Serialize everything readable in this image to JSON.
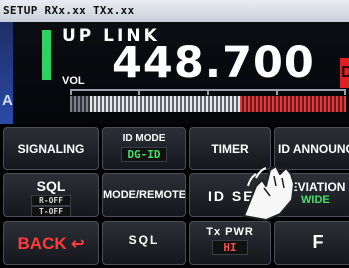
{
  "status_bar": {
    "text": "SETUP RXx.xx TXx.xx"
  },
  "display": {
    "band_label": "UP LINK",
    "frequency": "448.700",
    "volume_label": "VOL",
    "vfo_letter": "A",
    "mode_badge": "DN"
  },
  "buttons": {
    "signaling": "SIGNALING",
    "id_mode_label": "ID MODE",
    "id_mode_value": "DG-ID",
    "timer": "TIMER",
    "id_announce": "ID ANNOUNCE",
    "sql_label": "SQL",
    "sql_r": "R-OFF",
    "sql_t": "T-OFF",
    "mode_remote": "MODE/REMOTE",
    "id_select": "ID SEL",
    "deviation_label": "DEVIATION",
    "deviation_value": "WIDE",
    "back": "BACK",
    "back_arrow": "↩",
    "sql_bottom": "SQL",
    "tx_pwr_label": "Tx PWR",
    "tx_pwr_value": "HI",
    "f_key": "F"
  },
  "colors": {
    "accent_green": "#2fd25f",
    "accent_red": "#e02020"
  }
}
